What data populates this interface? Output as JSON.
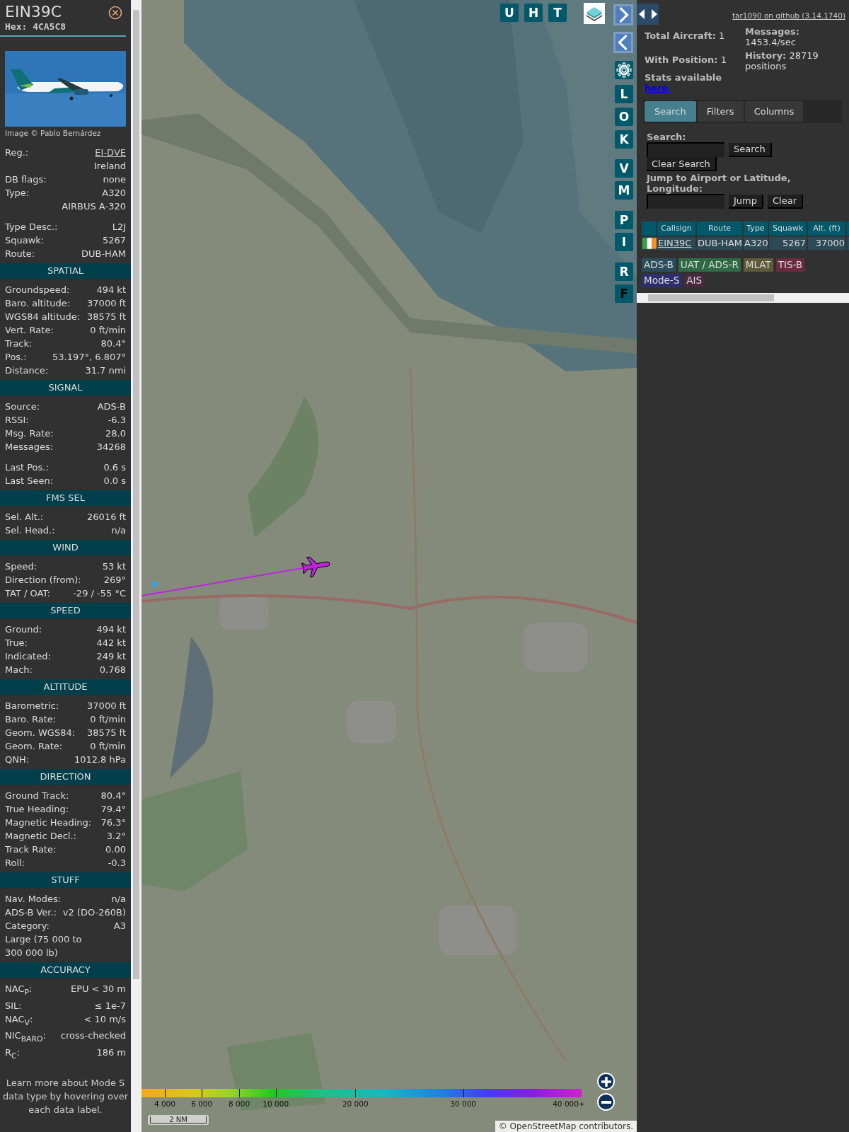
{
  "info": {
    "callsign": "EIN39C",
    "hex_label": "Hex:",
    "hex": "4CA5C8",
    "photo": {
      "kind": "picture"
    },
    "photo_credit": "Image © Pablo Bernárdez",
    "details": [
      [
        {
          "label": "Reg.:",
          "value": "EI-DVE",
          "link": true
        },
        {
          "value": "Ireland",
          "link": false
        },
        {
          "label": "DB flags:",
          "value": "none",
          "link": false
        },
        {
          "label": "Type:",
          "value": "A320",
          "link": false
        },
        {
          "value": "AIRBUS A-320",
          "link": false
        }
      ],
      [
        {
          "label": "Type Desc.:",
          "value": "L2J",
          "link": false
        },
        {
          "label": "Squawk:",
          "value": "5267",
          "link": false
        },
        {
          "label": "Route:",
          "value": "DUB-HAM",
          "link": false
        }
      ]
    ],
    "sections": [
      {
        "title": "SPATIAL",
        "groups": [
          [
            {
              "label": "Groundspeed:",
              "value": "494 kt"
            },
            {
              "label": "Baro. altitude:",
              "value": "37000 ft"
            },
            {
              "label": "WGS84 altitude:",
              "value": "38575 ft"
            },
            {
              "label": "Vert. Rate:",
              "value": "0 ft/min"
            },
            {
              "label": "Track:",
              "value": "80.4°"
            },
            {
              "label": "Pos.:",
              "value": "53.197°, 6.807°"
            },
            {
              "label": "Distance:",
              "value": "31.7 nmi"
            }
          ]
        ]
      },
      {
        "title": "SIGNAL",
        "groups": [
          [
            {
              "label": "Source:",
              "value": "ADS-B"
            },
            {
              "label": "RSSI:",
              "value": "-6.3"
            },
            {
              "label": "Msg. Rate:",
              "value": "28.0"
            },
            {
              "label": "Messages:",
              "value": "34268"
            }
          ],
          [
            {
              "label": "Last Pos.:",
              "value": "0.6 s"
            },
            {
              "label": "Last Seen:",
              "value": "0.0 s"
            }
          ]
        ]
      },
      {
        "title": "FMS SEL",
        "groups": [
          [
            {
              "label": "Sel. Alt.:",
              "value": "26016 ft"
            },
            {
              "label": "Sel. Head.:",
              "value": "n/a"
            }
          ]
        ]
      },
      {
        "title": "WIND",
        "groups": [
          [
            {
              "label": "Speed:",
              "value": "53 kt"
            },
            {
              "label": "Direction (from):",
              "value": "269°"
            },
            {
              "label": "TAT / OAT:",
              "value": "-29 / -55 °C"
            }
          ]
        ]
      },
      {
        "title": "SPEED",
        "groups": [
          [
            {
              "label": "Ground:",
              "value": "494 kt"
            },
            {
              "label": "True:",
              "value": "442 kt"
            },
            {
              "label": "Indicated:",
              "value": "249 kt"
            },
            {
              "label": "Mach:",
              "value": "0.768"
            }
          ]
        ]
      },
      {
        "title": "ALTITUDE",
        "groups": [
          [
            {
              "label": "Barometric:",
              "value": "37000 ft"
            },
            {
              "label": "Baro. Rate:",
              "value": "0 ft/min"
            },
            {
              "label": "Geom. WGS84:",
              "value": "38575 ft"
            },
            {
              "label": "Geom. Rate:",
              "value": "0 ft/min"
            },
            {
              "label": "QNH:",
              "value": "1012.8 hPa"
            }
          ]
        ]
      },
      {
        "title": "DIRECTION",
        "groups": [
          [
            {
              "label": "Ground Track:",
              "value": "80.4°"
            },
            {
              "label": "True Heading:",
              "value": "79.4°"
            },
            {
              "label": "Magnetic Heading:",
              "value": "76.3°"
            },
            {
              "label": "Magnetic Decl.:",
              "value": "3.2°"
            },
            {
              "label": "Track Rate:",
              "value": "0.00"
            },
            {
              "label": "Roll:",
              "value": "-0.3"
            }
          ]
        ]
      },
      {
        "title": "STUFF",
        "groups": [
          [
            {
              "label": "Nav. Modes:",
              "value": "n/a"
            },
            {
              "label": "ADS-B Ver.:",
              "value": "v2 (DO-260B)"
            },
            {
              "label": "Category:",
              "value": "A3"
            },
            {
              "label": "Large (75 000 to 300 000 lb)"
            }
          ]
        ]
      },
      {
        "title": "ACCURACY",
        "groups": [
          [
            {
              "label": "NAC$_{P}$:",
              "value": "EPU < 30 m"
            },
            {
              "label": "SIL:",
              "value": "≤ 1e-7"
            },
            {
              "label": "NAC$_{V}$:",
              "value": "< 10 m/s"
            },
            {
              "label": "NIC$_{BARO}$:",
              "value": "cross-checked"
            },
            {
              "label": "R$_{C}$:",
              "value": "186 m"
            }
          ]
        ]
      }
    ],
    "note": "Learn more about Mode S data type by hovering over each data label."
  },
  "map": {
    "picture": {
      "kind": "picture"
    },
    "top_buttons": [
      "U",
      "H",
      "T"
    ],
    "side_buttons": [
      "L",
      "O",
      "K",
      "V",
      "M",
      "P",
      "I",
      "R",
      "F"
    ],
    "altitude_ticks": [
      "4 000",
      "6 000",
      "8 000",
      "10 000",
      "20 000",
      "30 000",
      "40 000+"
    ],
    "scale": "2 NM",
    "attribution": {
      "symbol": "©",
      "link": "OpenStreetMap",
      "text": "contributors."
    }
  },
  "panel": {
    "version_link": "tar1090 on github (3.14.1740)",
    "stats_left": [
      {
        "label": "Total Aircraft:",
        "value": "1"
      },
      {
        "label": "With Position:",
        "value": "1"
      }
    ],
    "stats_note": "Stats available",
    "stats_link": "here",
    "stats_right": [
      {
        "label": "Messages:",
        "value": "1453.4/sec"
      },
      {
        "label": "History:",
        "value": "28719 positions"
      }
    ],
    "tabs": [
      {
        "label": "Search",
        "selected": true
      },
      {
        "label": "Filters",
        "selected": false
      },
      {
        "label": "Columns",
        "selected": false
      }
    ],
    "search_label": "Search:",
    "search_button": "Search",
    "clear_search_button": "Clear Search",
    "jump_label": "Jump to Airport or Latitude, Longitude:",
    "jump_button": "Jump",
    "clear_button": "Clear",
    "table": {
      "columns": [
        "Callsign",
        "Route",
        "Type",
        "Squawk",
        "Alt. (ft)"
      ],
      "rows": [
        {
          "cells": [
            "EIN39C",
            "DUB-HAM",
            "A320",
            "5267",
            "37000"
          ]
        }
      ]
    },
    "sources": [
      {
        "label": "ADS-B",
        "color": "#2b4e5e"
      },
      {
        "label": "UAT / ADS-R",
        "color": "#2e6a45"
      },
      {
        "label": "MLAT",
        "color": "#5f5a3a"
      },
      {
        "label": "TIS-B",
        "color": "#6b2a40"
      },
      {
        "label": "Mode-S",
        "color": "#2e2e6e"
      },
      {
        "label": "AIS",
        "color": "#4a2840"
      }
    ]
  }
}
